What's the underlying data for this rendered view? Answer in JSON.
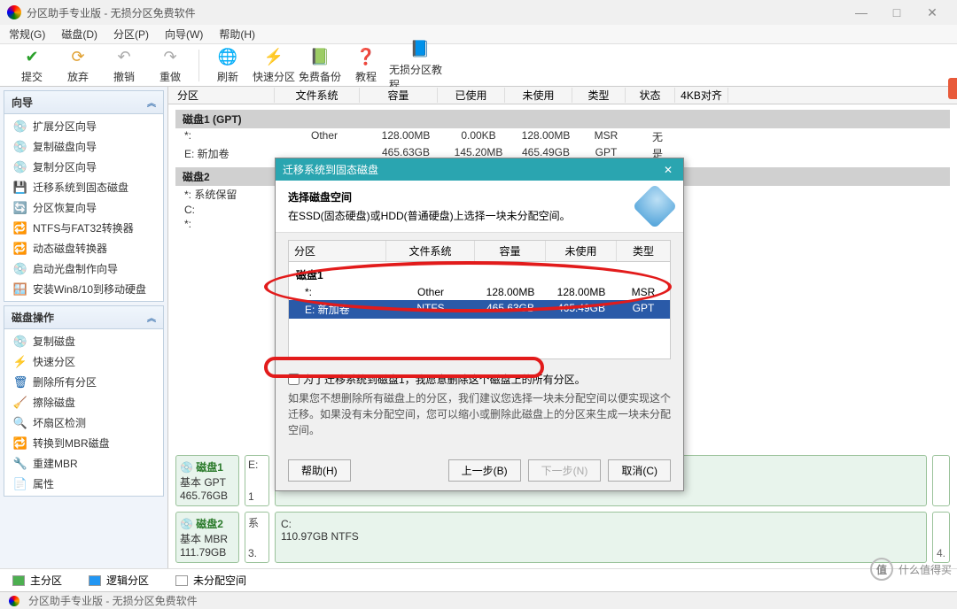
{
  "titlebar": {
    "title": "分区助手专业版 - 无损分区免费软件"
  },
  "menu": {
    "general": "常规(G)",
    "disk": "磁盘(D)",
    "partition": "分区(P)",
    "wizard": "向导(W)",
    "help": "帮助(H)"
  },
  "toolbar": {
    "submit": "提交",
    "discard": "放弃",
    "undo": "撤销",
    "redo": "重做",
    "refresh": "刷新",
    "quickpart": "快速分区",
    "backup": "免费备份",
    "course": "教程",
    "lossless": "无损分区教程"
  },
  "sidebar": {
    "wizard": {
      "title": "向导",
      "items": [
        "扩展分区向导",
        "复制磁盘向导",
        "复制分区向导",
        "迁移系统到固态磁盘",
        "分区恢复向导",
        "NTFS与FAT32转换器",
        "动态磁盘转换器",
        "启动光盘制作向导",
        "安装Win8/10到移动硬盘"
      ]
    },
    "diskops": {
      "title": "磁盘操作",
      "items": [
        "复制磁盘",
        "快速分区",
        "删除所有分区",
        "擦除磁盘",
        "坏扇区检测",
        "转换到MBR磁盘",
        "重建MBR",
        "属性"
      ]
    }
  },
  "grid": {
    "headers": {
      "partition": "分区",
      "fs": "文件系统",
      "capacity": "容量",
      "used": "已使用",
      "free": "未使用",
      "type": "类型",
      "status": "状态",
      "align4k": "4KB对齐"
    },
    "disk1": {
      "title": "磁盘1 (GPT)",
      "rows": [
        {
          "part": "*:",
          "fs": "Other",
          "cap": "128.00MB",
          "used": "0.00KB",
          "free": "128.00MB",
          "type": "MSR",
          "stat": "无"
        },
        {
          "part": "E: 新加卷",
          "fs": "",
          "cap": "465.63GB",
          "used": "145.20MB",
          "free": "465.49GB",
          "type": "GPT",
          "stat": "是"
        }
      ]
    },
    "disk2": {
      "title": "磁盘2",
      "rows": [
        {
          "part": "*: 系统保留",
          "fs": "",
          "cap": "",
          "used": "",
          "free": "",
          "type": "",
          "stat": ""
        },
        {
          "part": "C:",
          "fs": "",
          "cap": "",
          "used": "",
          "free": "",
          "type": "",
          "stat": ""
        },
        {
          "part": "*:",
          "fs": "",
          "cap": "",
          "used": "",
          "free": "",
          "type": "",
          "stat": ""
        }
      ]
    }
  },
  "diskbar": {
    "d1": {
      "name": "磁盘1",
      "sub1": "基本 GPT",
      "sub2": "465.76GB",
      "seg_a_top": "E:",
      "seg_a_bot": "1",
      "seg_last": ""
    },
    "d2": {
      "name": "磁盘2",
      "sub1": "基本 MBR",
      "sub2": "111.79GB",
      "seg_a_top": "系",
      "seg_a_bot": "3.",
      "main": "C:",
      "main_sz": "110.97GB NTFS",
      "seg_last": "4."
    }
  },
  "legend": {
    "primary": "主分区",
    "logical": "逻辑分区",
    "unalloc": "未分配空间"
  },
  "dialog": {
    "title": "迁移系统到固态磁盘",
    "head_title": "选择磁盘空间",
    "head_desc": "在SSD(固态硬盘)或HDD(普通硬盘)上选择一块未分配空间。",
    "cols": {
      "partition": "分区",
      "fs": "文件系统",
      "capacity": "容量",
      "free": "未使用",
      "type": "类型"
    },
    "disk_label": "磁盘1",
    "rows": [
      {
        "part": "*:",
        "fs": "Other",
        "cap": "128.00MB",
        "free": "128.00MB",
        "type": "MSR"
      },
      {
        "part": "E: 新加卷",
        "fs": "NTFS",
        "cap": "465.63GB",
        "free": "465.49GB",
        "type": "GPT"
      }
    ],
    "check_label": "为了迁移系统到磁盘1，我愿意删除这个磁盘上的所有分区。",
    "note": "如果您不想删除所有磁盘上的分区，我们建议您选择一块未分配空间以便实现这个迁移。如果没有未分配空间，您可以缩小或删除此磁盘上的分区来生成一块未分配空间。",
    "help_btn": "帮助(H)",
    "prev_btn": "上一步(B)",
    "next_btn": "下一步(N)",
    "cancel_btn": "取消(C)"
  },
  "statusbar": {
    "text": "分区助手专业版 - 无损分区免费软件"
  },
  "watermark": {
    "char": "值",
    "text": "什么值得买"
  }
}
